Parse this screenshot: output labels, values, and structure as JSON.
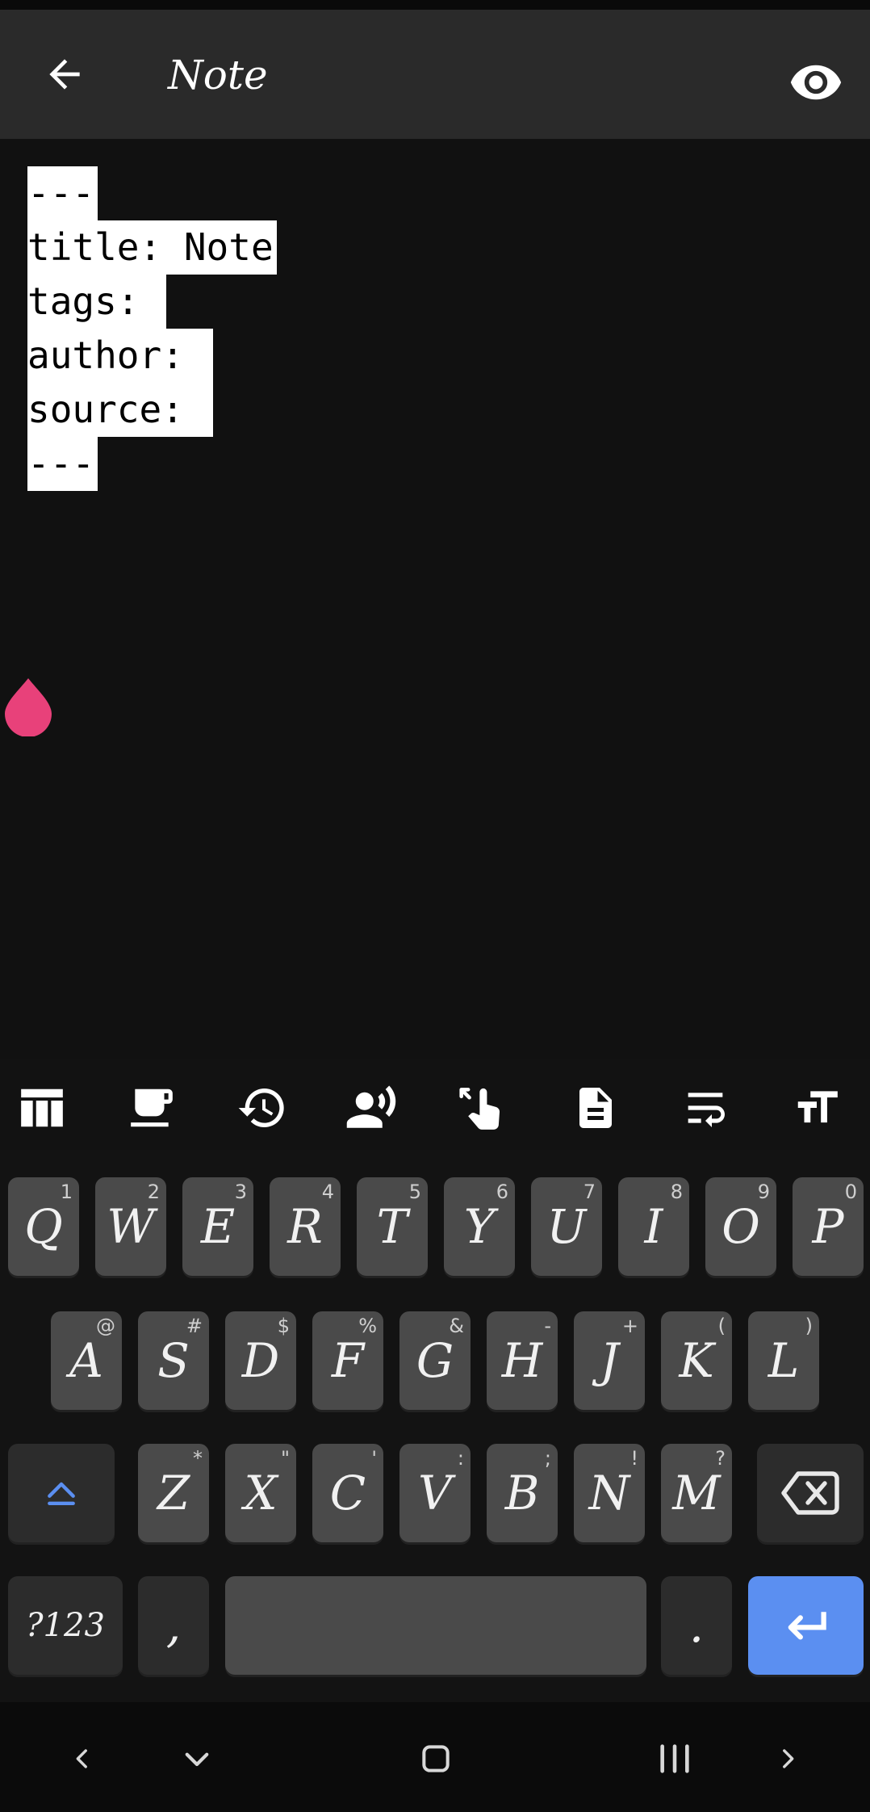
{
  "appbar": {
    "title": "Note"
  },
  "editor": {
    "lines": [
      "---",
      "title: Note",
      "tags:",
      "author:",
      "source:",
      "---"
    ]
  },
  "toolbar": {
    "icons": [
      "table-icon",
      "coffee-cup-icon",
      "history-icon",
      "voice-icon",
      "touch-gesture-icon",
      "document-icon",
      "wrap-text-icon",
      "text-size-icon"
    ]
  },
  "keyboard": {
    "row1": [
      {
        "label": "Q",
        "hint": "1"
      },
      {
        "label": "W",
        "hint": "2"
      },
      {
        "label": "E",
        "hint": "3"
      },
      {
        "label": "R",
        "hint": "4"
      },
      {
        "label": "T",
        "hint": "5"
      },
      {
        "label": "Y",
        "hint": "6"
      },
      {
        "label": "U",
        "hint": "7"
      },
      {
        "label": "I",
        "hint": "8"
      },
      {
        "label": "O",
        "hint": "9"
      },
      {
        "label": "P",
        "hint": "0"
      }
    ],
    "row2": [
      {
        "label": "A",
        "hint": "@"
      },
      {
        "label": "S",
        "hint": "#"
      },
      {
        "label": "D",
        "hint": "$"
      },
      {
        "label": "F",
        "hint": "%"
      },
      {
        "label": "G",
        "hint": "&"
      },
      {
        "label": "H",
        "hint": "-"
      },
      {
        "label": "J",
        "hint": "+"
      },
      {
        "label": "K",
        "hint": "("
      },
      {
        "label": "L",
        "hint": ")"
      }
    ],
    "row3": [
      {
        "label": "Z",
        "hint": "*"
      },
      {
        "label": "X",
        "hint": "\""
      },
      {
        "label": "C",
        "hint": "'"
      },
      {
        "label": "V",
        "hint": ":"
      },
      {
        "label": "B",
        "hint": ";"
      },
      {
        "label": "N",
        "hint": "!"
      },
      {
        "label": "M",
        "hint": "?"
      }
    ],
    "symbols_label": "?123",
    "comma": ",",
    "period": ".",
    "accent_color": "#5b8ff1"
  },
  "colors": {
    "cursor_handle": "#e8417a",
    "appbar": "#2a2a2a"
  }
}
